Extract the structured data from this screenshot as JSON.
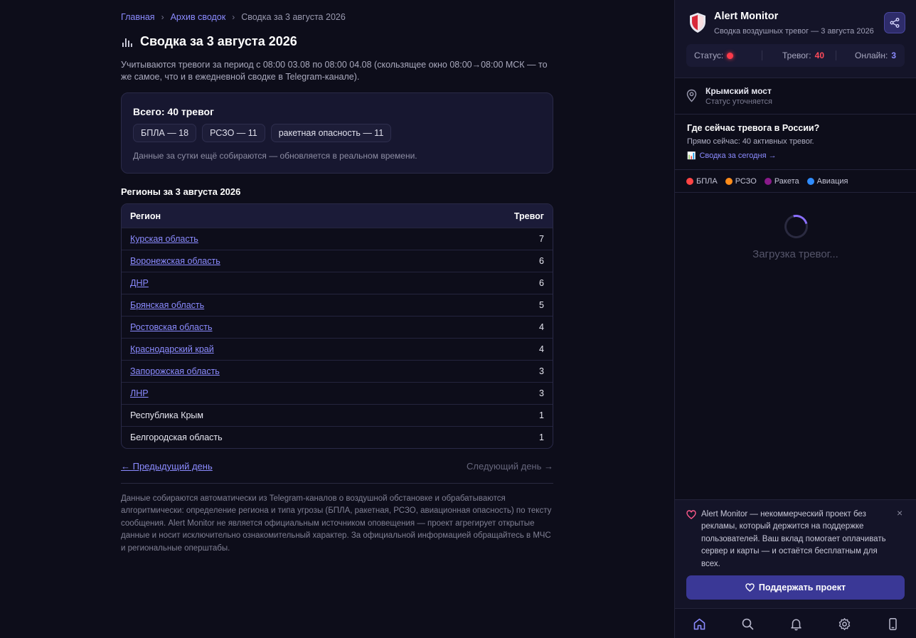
{
  "breadcrumb": {
    "home": "Главная",
    "archive": "Архив сводок",
    "current": "Сводка за 3 августа 2026",
    "separator": "›"
  },
  "page": {
    "title": "Сводка за 3 августа 2026",
    "intro": "Учитываются тревоги за период с 08:00 03.08 по 08:00 04.08 (скользящее окно 08:00→08:00 МСК — то же самое, что и в ежедневной сводке в Telegram-канале)."
  },
  "summary": {
    "total": "Всего: 40 тревог",
    "chips": [
      "БПЛА — 18",
      "РСЗО — 11",
      "ракетная опасность — 11"
    ],
    "note": "Данные за сутки ещё собираются — обновляется в реальном времени."
  },
  "regions": {
    "title": "Регионы за 3 августа 2026",
    "col_region": "Регион",
    "col_alerts": "Тревог",
    "rows": [
      {
        "name": "Курская область",
        "count": "7",
        "link": true
      },
      {
        "name": "Воронежская область",
        "count": "6",
        "link": true
      },
      {
        "name": "ДНР",
        "count": "6",
        "link": true
      },
      {
        "name": "Брянская область",
        "count": "5",
        "link": true
      },
      {
        "name": "Ростовская область",
        "count": "4",
        "link": true
      },
      {
        "name": "Краснодарский край",
        "count": "4",
        "link": true
      },
      {
        "name": "Запорожская область",
        "count": "3",
        "link": true
      },
      {
        "name": "ЛНР",
        "count": "3",
        "link": true
      },
      {
        "name": "Республика Крым",
        "count": "1",
        "link": false
      },
      {
        "name": "Белгородская область",
        "count": "1",
        "link": false
      }
    ]
  },
  "day_nav": {
    "prev": "← Предыдущий день",
    "next": "Следующий день →"
  },
  "disclaimer": "Данные собираются автоматически из Telegram-каналов о воздушной обстановке и обрабатываются алгоритмически: определение региона и типа угрозы (БПЛА, ракетная, РСЗО, авиационная опасность) по тексту сообщения. Alert Monitor не является официальным источником оповещения — проект агрегирует открытые данные и носит исключительно ознакомительный характер. За официальной информацией обращайтесь в МЧС и региональные оперштабы.",
  "sidebar": {
    "app_title": "Alert Monitor",
    "app_subtitle": "Сводка воздушных тревог — 3 августа 2026",
    "status_label": "Статус:",
    "alerts_label": "Тревог:",
    "alerts_value": "40",
    "online_label": "Онлайн:",
    "online_value": "3",
    "status_color": "#ff3a4a",
    "bridge_title": "Крымский мост",
    "bridge_status": "Статус уточняется",
    "where_title": "Где сейчас тревога в России?",
    "where_now": "Прямо сейчас: 40 активных тревог.",
    "where_link": "Сводка за сегодня →",
    "legend": [
      {
        "label": "БПЛА",
        "color": "#ff4444"
      },
      {
        "label": "РСЗО",
        "color": "#ff8c1a"
      },
      {
        "label": "Ракета",
        "color": "#8a1a8a"
      },
      {
        "label": "Авиация",
        "color": "#2f8cff"
      }
    ],
    "loading": "Загрузка тревог...",
    "donate_text": "Alert Monitor — некоммерческий проект без рекламы, который держится на поддержке пользователей. Ваш вклад помогает оплачивать сервер и карты — и остаётся бесплатным для всех.",
    "donate_close": "×",
    "donate_button": "Поддержать проект"
  },
  "icons": {
    "chart": "bar-chart-icon",
    "share": "share-icon",
    "pin": "map-pin-icon",
    "heart": "heart-icon",
    "nav": [
      "home-icon",
      "search-icon",
      "bell-icon",
      "gear-icon",
      "phone-icon"
    ]
  }
}
